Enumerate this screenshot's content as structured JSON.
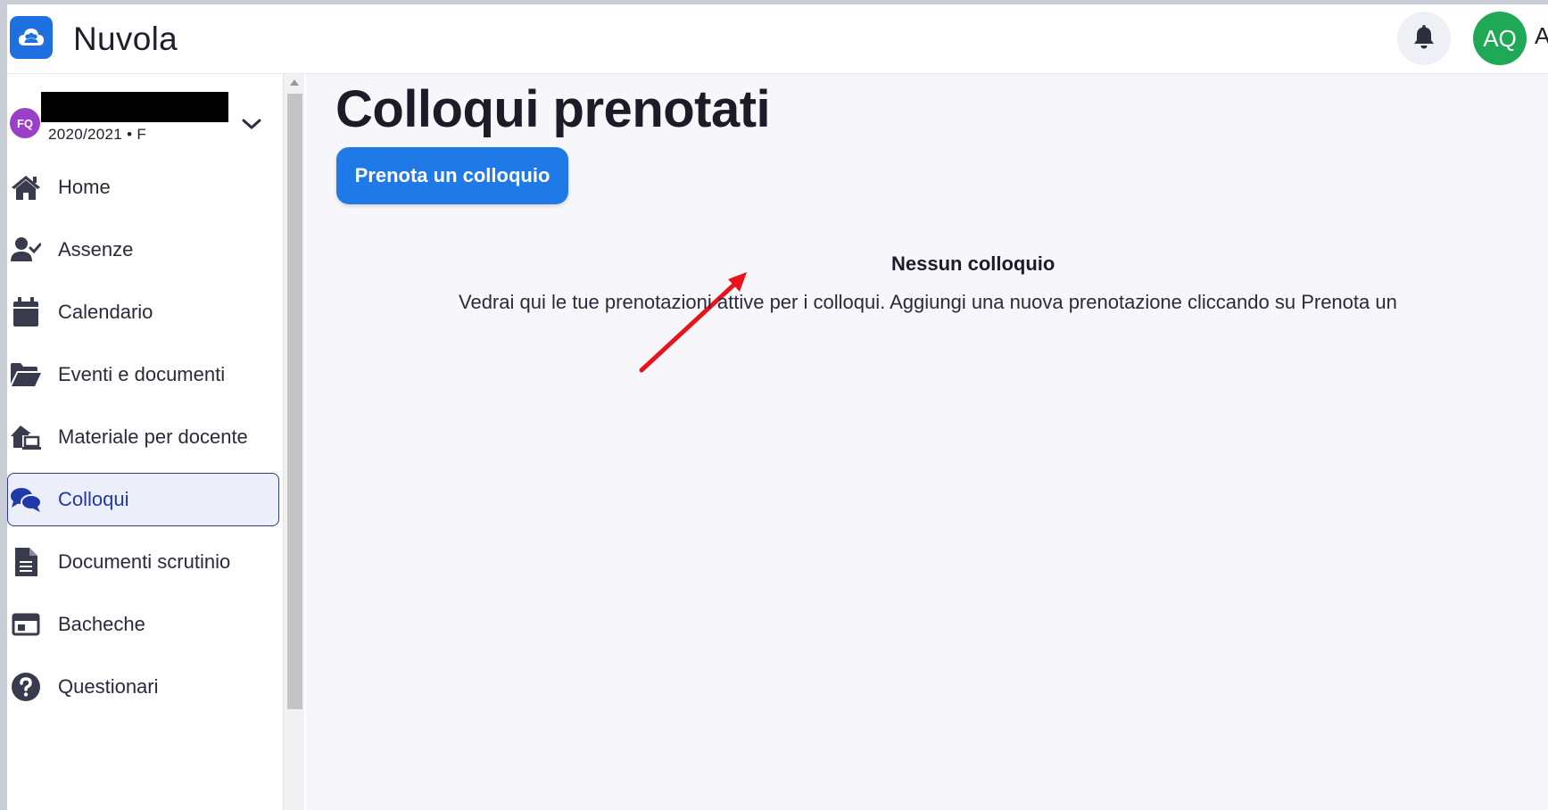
{
  "app": {
    "brand_name": "Nuvola",
    "brand_color": "#1e6fe0",
    "logo_icon": "cloud-people-icon"
  },
  "header": {
    "notification_icon": "bell-icon",
    "user_initials": "AQ",
    "user_name_partial": "A",
    "user_avatar_color": "#1fa855"
  },
  "student": {
    "initials": "FQ",
    "name_redacted": true,
    "year_class": "2020/2021 • F",
    "avatar_color": "#9b3fc9"
  },
  "sidebar": {
    "items": [
      {
        "label": "Home",
        "icon": "home-icon",
        "active": false
      },
      {
        "label": "Assenze",
        "icon": "user-check-icon",
        "active": false
      },
      {
        "label": "Calendario",
        "icon": "calendar-icon",
        "active": false
      },
      {
        "label": "Eventi e documenti",
        "icon": "folder-open-icon",
        "active": false
      },
      {
        "label": "Materiale per docente",
        "icon": "house-laptop-icon",
        "active": false
      },
      {
        "label": "Colloqui",
        "icon": "chat-bubbles-icon",
        "active": true
      },
      {
        "label": "Documenti scrutinio",
        "icon": "file-text-icon",
        "active": false
      },
      {
        "label": "Bacheche",
        "icon": "board-icon",
        "active": false
      },
      {
        "label": "Questionari",
        "icon": "question-circle-icon",
        "active": false
      }
    ]
  },
  "main": {
    "title": "Colloqui prenotati",
    "book_button_label": "Prenota un colloquio",
    "empty_title": "Nessun colloquio",
    "empty_text": "Vedrai qui le tue prenotazioni attive per i colloqui. Aggiungi una nuova prenotazione cliccando su Prenota un",
    "accent_color": "#1f7ae8",
    "annotation_arrow_color": "#e8141b"
  }
}
